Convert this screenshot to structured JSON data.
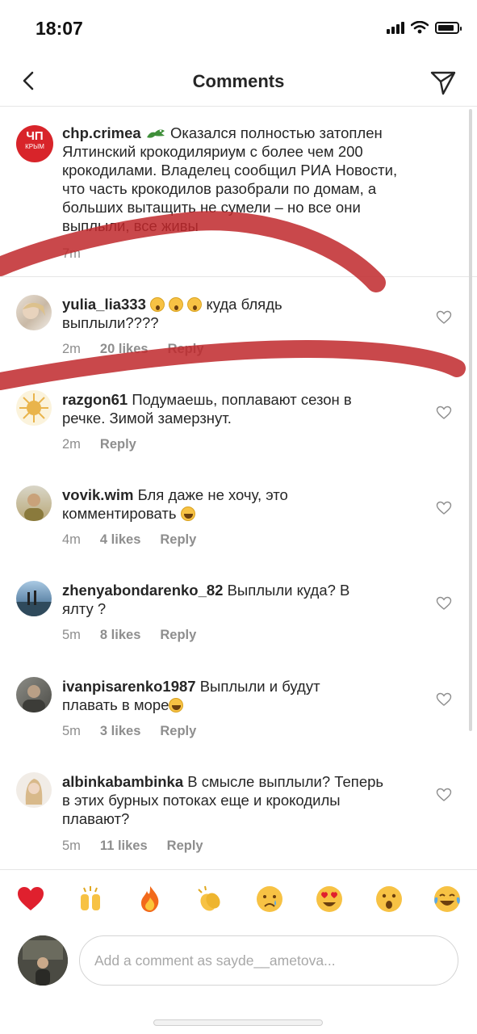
{
  "status_bar": {
    "time": "18:07",
    "battery_level": 0.85
  },
  "header": {
    "title": "Comments"
  },
  "caption": {
    "username": "chp.crimea",
    "avatar_text_big": "ЧП",
    "avatar_text_small": "КРЫМ",
    "lines": [
      "Оказался полностью затоплен",
      "Ялтинский крокодиляриум с более чем 200",
      "крокодилами. Владелец сообщил РИА Новости,",
      "что часть крокодилов разобрали по домам, а",
      "больших вытащить не сумели – но все они",
      "выплыли, все живы"
    ],
    "time": "7m"
  },
  "comments": [
    {
      "username": "yulia_lia333",
      "text_before": "",
      "text_after": " куда блядь",
      "line2": "выплыли????",
      "emoji": [
        "wow",
        "wow",
        "wow"
      ],
      "time": "2m",
      "likes": "20 likes",
      "reply": "Reply"
    },
    {
      "username": "razgon61",
      "text_before": "Подумаешь, поплавают сезон в",
      "line2": "речке. Зимой замерзнут.",
      "time": "2m",
      "reply": "Reply"
    },
    {
      "username": "vovik.wim",
      "text_before": "Бля даже не хочу, это",
      "line2": "комментировать",
      "emoji": [
        "laugh"
      ],
      "time": "4m",
      "likes": "4 likes",
      "reply": "Reply"
    },
    {
      "username": "zhenyabondarenko_82",
      "text_before": "Выплыли куда? В",
      "line2": "ялту ?",
      "time": "5m",
      "likes": "8 likes",
      "reply": "Reply"
    },
    {
      "username": "ivanpisarenko1987",
      "text_before": "Выплыли  и будут",
      "line2": "плавать в море",
      "emoji": [
        "laugh"
      ],
      "time": "5m",
      "likes": "3 likes",
      "reply": "Reply"
    },
    {
      "username": "albinkabambinka",
      "text_before": "В смысле выплыли? Теперь",
      "line2": "в этих бурных потоках еще и крокодилы",
      "line3": "плавают?",
      "time": "5m",
      "likes": "11 likes",
      "reply": "Reply"
    }
  ],
  "reactions": [
    "red-heart",
    "raising-hands",
    "fire",
    "clapping-hands",
    "crying-face",
    "heart-eyes-face",
    "astonished-face",
    "tears-of-joy-face"
  ],
  "composer": {
    "placeholder": "Add a comment as sayde__ametova..."
  },
  "colors": {
    "text": "#262626",
    "muted": "#8e8e8e",
    "brand_red": "#d8242a",
    "scribble_red": "#c0282b",
    "divider": "#e6e6e6"
  }
}
